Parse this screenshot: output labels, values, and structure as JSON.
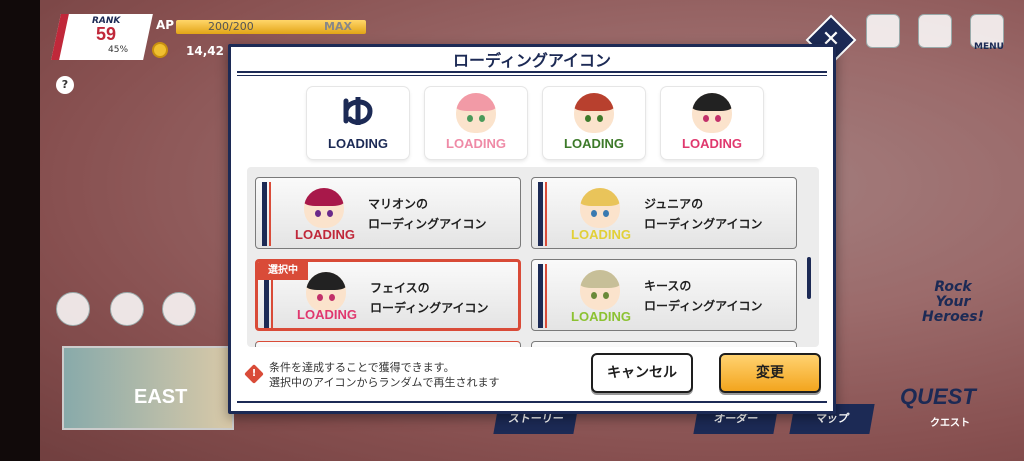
{
  "hud": {
    "rank_label": "RANK",
    "rank_value": "59",
    "rank_progress": "45%",
    "ap_label": "AP",
    "ap_value": "200/200",
    "ap_fraction": 1.0,
    "ap_max": "MAX",
    "coins": "14,42",
    "help": "?",
    "menu_label": "MENU"
  },
  "bottom_hud": {
    "event_title": "EAST",
    "nav": [
      "ストーリー",
      "オーダー",
      "マップ"
    ],
    "quest_label": "QUEST",
    "quest_sub": "クエスト",
    "logo": "Rock\nYour\nHeroes!"
  },
  "dialog": {
    "title": "ローディングアイコン",
    "previews": [
      {
        "text": "LOADING",
        "color": "#1c2a55",
        "icon": "logo-icon"
      },
      {
        "text": "LOADING",
        "color": "#ef8aa6",
        "icon": "pink-hair-face-icon"
      },
      {
        "text": "LOADING",
        "color": "#3d7a2a",
        "icon": "red-hair-face-icon"
      },
      {
        "text": "LOADING",
        "color": "#e0386e",
        "icon": "black-hair-face-icon"
      }
    ],
    "cards": [
      {
        "line1": "マリオンの",
        "line2": "ローディングアイコン",
        "loading": "LOADING",
        "loading_color": "#c0283a",
        "icon": "magenta-hair-face-icon",
        "selected": false
      },
      {
        "line1": "ジュニアの",
        "line2": "ローディングアイコン",
        "loading": "LOADING",
        "loading_color": "#e2d038",
        "icon": "blonde-hair-face-icon",
        "selected": false
      },
      {
        "line1": "フェイスの",
        "line2": "ローディングアイコン",
        "loading": "LOADING",
        "loading_color": "#e0386e",
        "icon": "black-hair-face-icon",
        "selected": true
      },
      {
        "line1": "キースの",
        "line2": "ローディングアイコン",
        "loading": "LOADING",
        "loading_color": "#8cc232",
        "icon": "ash-hair-face-icon",
        "selected": false
      }
    ],
    "selected_badge": "選択中",
    "note_line1": "条件を達成することで獲得できます。",
    "note_line2": "選択中のアイコンからランダムで再生されます",
    "cancel_label": "キャンセル",
    "change_label": "変更"
  }
}
